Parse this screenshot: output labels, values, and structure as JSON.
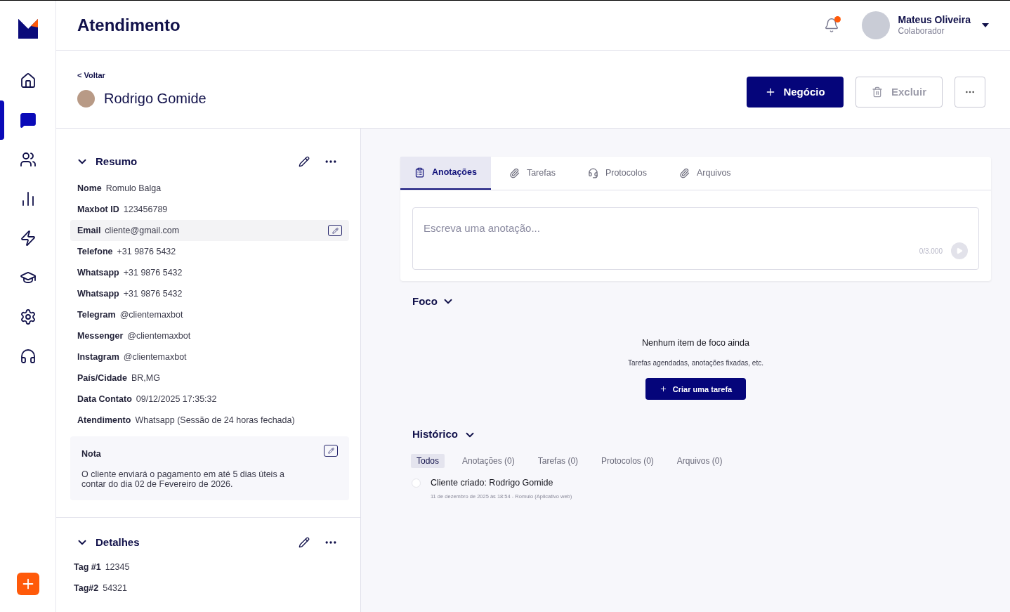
{
  "sidebar": {
    "items": [
      {
        "selected": false
      },
      {
        "selected": true
      },
      {
        "selected": false
      },
      {
        "selected": false
      },
      {
        "selected": false
      },
      {
        "selected": false
      },
      {
        "selected": false
      },
      {
        "selected": false
      }
    ]
  },
  "topbar": {
    "title": "Atendimento",
    "notification": true,
    "user": {
      "name": "Mateus Oliveira",
      "role": "Colaborador"
    }
  },
  "header": {
    "back": "< Voltar",
    "client": "Rodrigo Gomide",
    "buttons": {
      "primary": "Negócio",
      "delete": "Excluir"
    }
  },
  "summary": {
    "title": "Resumo",
    "fields": [
      {
        "label": "Nome",
        "value": "Romulo Balga",
        "highlighted": false
      },
      {
        "label": "Maxbot ID",
        "value": "123456789",
        "highlighted": false
      },
      {
        "label": "Email",
        "value": "cliente@gmail.com",
        "highlighted": true
      },
      {
        "label": "Telefone",
        "value": "+31 9876 5432",
        "highlighted": false
      },
      {
        "label": "Whatsapp",
        "value": "+31 9876 5432",
        "highlighted": false
      },
      {
        "label": "Whatsapp",
        "value": "+31 9876 5432",
        "highlighted": false
      },
      {
        "label": "Telegram",
        "value": "@clientemaxbot",
        "highlighted": false
      },
      {
        "label": "Messenger",
        "value": "@clientemaxbot",
        "highlighted": false
      },
      {
        "label": "Instagram",
        "value": "@clientemaxbot",
        "highlighted": false
      },
      {
        "label": "País/Cidade",
        "value": "BR,MG",
        "highlighted": false
      },
      {
        "label": "Data Contato",
        "value": "09/12/2025 17:35:32",
        "highlighted": false
      },
      {
        "label": "Atendimento",
        "value": "Whatsapp (Sessão de 24 horas fechada)",
        "highlighted": false
      }
    ],
    "note": {
      "title": "Nota",
      "text": "O cliente enviará o pagamento em até 5 dias úteis a contar do dia 02 de Fevereiro de 2026."
    }
  },
  "details": {
    "title": "Detalhes",
    "fields": [
      {
        "label": "Tag #1",
        "value": "12345"
      },
      {
        "label": "Tag#2",
        "value": "54321"
      }
    ]
  },
  "tabs": [
    {
      "label": "Anotações",
      "selected": true
    },
    {
      "label": "Tarefas",
      "selected": false
    },
    {
      "label": "Protocolos",
      "selected": false
    },
    {
      "label": "Arquivos",
      "selected": false
    }
  ],
  "annotation": {
    "placeholder": "Escreva uma anotação...",
    "counter": "0/3.000"
  },
  "focus": {
    "title": "Foco",
    "empty_title": "Nenhum item de foco ainda",
    "empty_text": "Tarefas agendadas, anotações fixadas, etc.",
    "button": "Criar uma tarefa"
  },
  "history": {
    "title": "Histórico",
    "filters": [
      {
        "label": "Todos",
        "selected": true
      },
      {
        "label": "Anotações (0)",
        "selected": false
      },
      {
        "label": "Tarefas (0)",
        "selected": false
      },
      {
        "label": "Protocolos (0)",
        "selected": false
      },
      {
        "label": "Arquivos (0)",
        "selected": false
      }
    ],
    "events": [
      {
        "title": "Cliente criado: Rodrigo Gomide",
        "meta": "11 de dezembro de 2025 às 18:54 - Romulo (Aplicativo web)"
      }
    ]
  }
}
